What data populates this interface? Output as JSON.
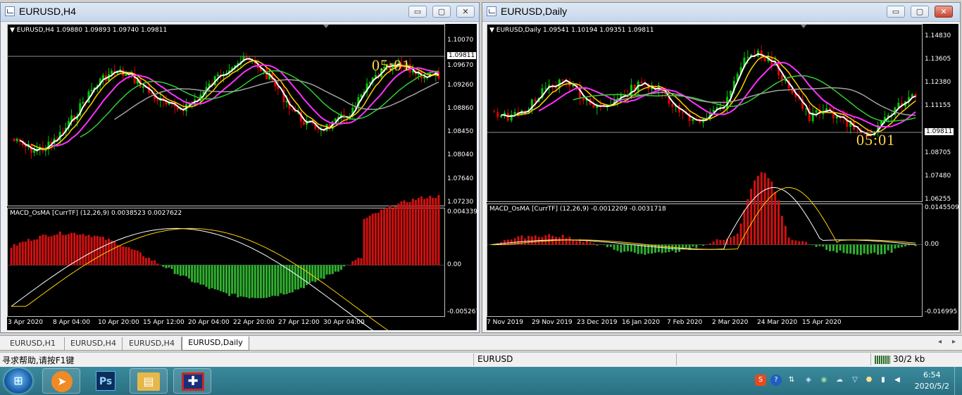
{
  "windows": [
    {
      "title": "EURUSD,H4",
      "header": "▼ EURUSD,H4  1.09880 1.09893 1.09740 1.09811",
      "timer": "05:01",
      "price_labels": [
        "1.10070",
        "1.09811",
        "1.09670",
        "1.09260",
        "1.08860",
        "1.08450",
        "1.08040",
        "1.07640",
        "1.07230"
      ],
      "current_price": "1.09811",
      "indicator_header": "MACD_OsMA [CurrTF] (12,26,9) 0.0038523 0.0027622",
      "indicator_labels": [
        "0.0043393",
        "0.00",
        "-0.005267"
      ],
      "time_labels": [
        "3 Apr 2020",
        "8 Apr 04:00",
        "10 Apr 20:00",
        "15 Apr 12:00",
        "20 Apr 04:00",
        "22 Apr 20:00",
        "27 Apr 12:00",
        "30 Apr 04:00"
      ]
    },
    {
      "title": "EURUSD,Daily",
      "header": "▼ EURUSD,Daily  1.09541 1.10194 1.09351 1.09811",
      "timer": "05:01",
      "price_labels": [
        "1.14830",
        "1.13605",
        "1.12380",
        "1.11155",
        "1.09811",
        "1.08705",
        "1.07480",
        "1.06255"
      ],
      "current_price": "1.09811",
      "indicator_header": "MACD_OsMA [CurrTF] (12,26,9) -0.0012209 -0.0031718",
      "indicator_labels": [
        "0.0145509",
        "0.00",
        "-0.016995"
      ],
      "time_labels": [
        "7 Nov 2019",
        "29 Nov 2019",
        "23 Dec 2019",
        "16 Jan 2020",
        "7 Feb 2020",
        "2 Mar 2020",
        "24 Mar 2020",
        "15 Apr 2020"
      ]
    }
  ],
  "window_buttons": {
    "minimize": "▭",
    "restore": "▢",
    "close": "✕"
  },
  "tabs": [
    "EURUSD,H1",
    "EURUSD,H4",
    "EURUSD,H4",
    "EURUSD,Daily"
  ],
  "active_tab": 3,
  "tab_arrows": {
    "left": "◂",
    "right": "▸"
  },
  "status": {
    "help": "寻求帮助,请按F1键",
    "symbol": "EURUSD",
    "traffic": "30/2 kb"
  },
  "taskbar": {
    "start_glyph": "⊞",
    "apps": [
      {
        "name": "trader-icon",
        "glyph": "➤",
        "color": "#f08a24"
      },
      {
        "name": "photoshop-icon",
        "glyph": "Ps",
        "color": "#0b2f5a"
      },
      {
        "name": "explorer-icon",
        "glyph": "▤",
        "color": "#e6b84a"
      },
      {
        "name": "mt4-icon",
        "glyph": "✚",
        "color": "#c62828"
      }
    ],
    "tray_glyphs": [
      "S",
      "?",
      "⇅",
      "◈",
      "◉",
      "☁",
      "▽",
      "⬣",
      "▮",
      "◀"
    ],
    "time": "6:54",
    "date": "2020/5/2"
  },
  "colors": {
    "bull": "#00c800",
    "bear": "#e00000",
    "ma_white": "#ffffff",
    "ma_yellow": "#ffd000",
    "ma_magenta": "#ff30ff",
    "ma_green": "#32cd32",
    "ma_gray": "#a0a0a0",
    "hist_red": "#d01010",
    "hist_green": "#30b030",
    "timer": "#ffd54a"
  }
}
